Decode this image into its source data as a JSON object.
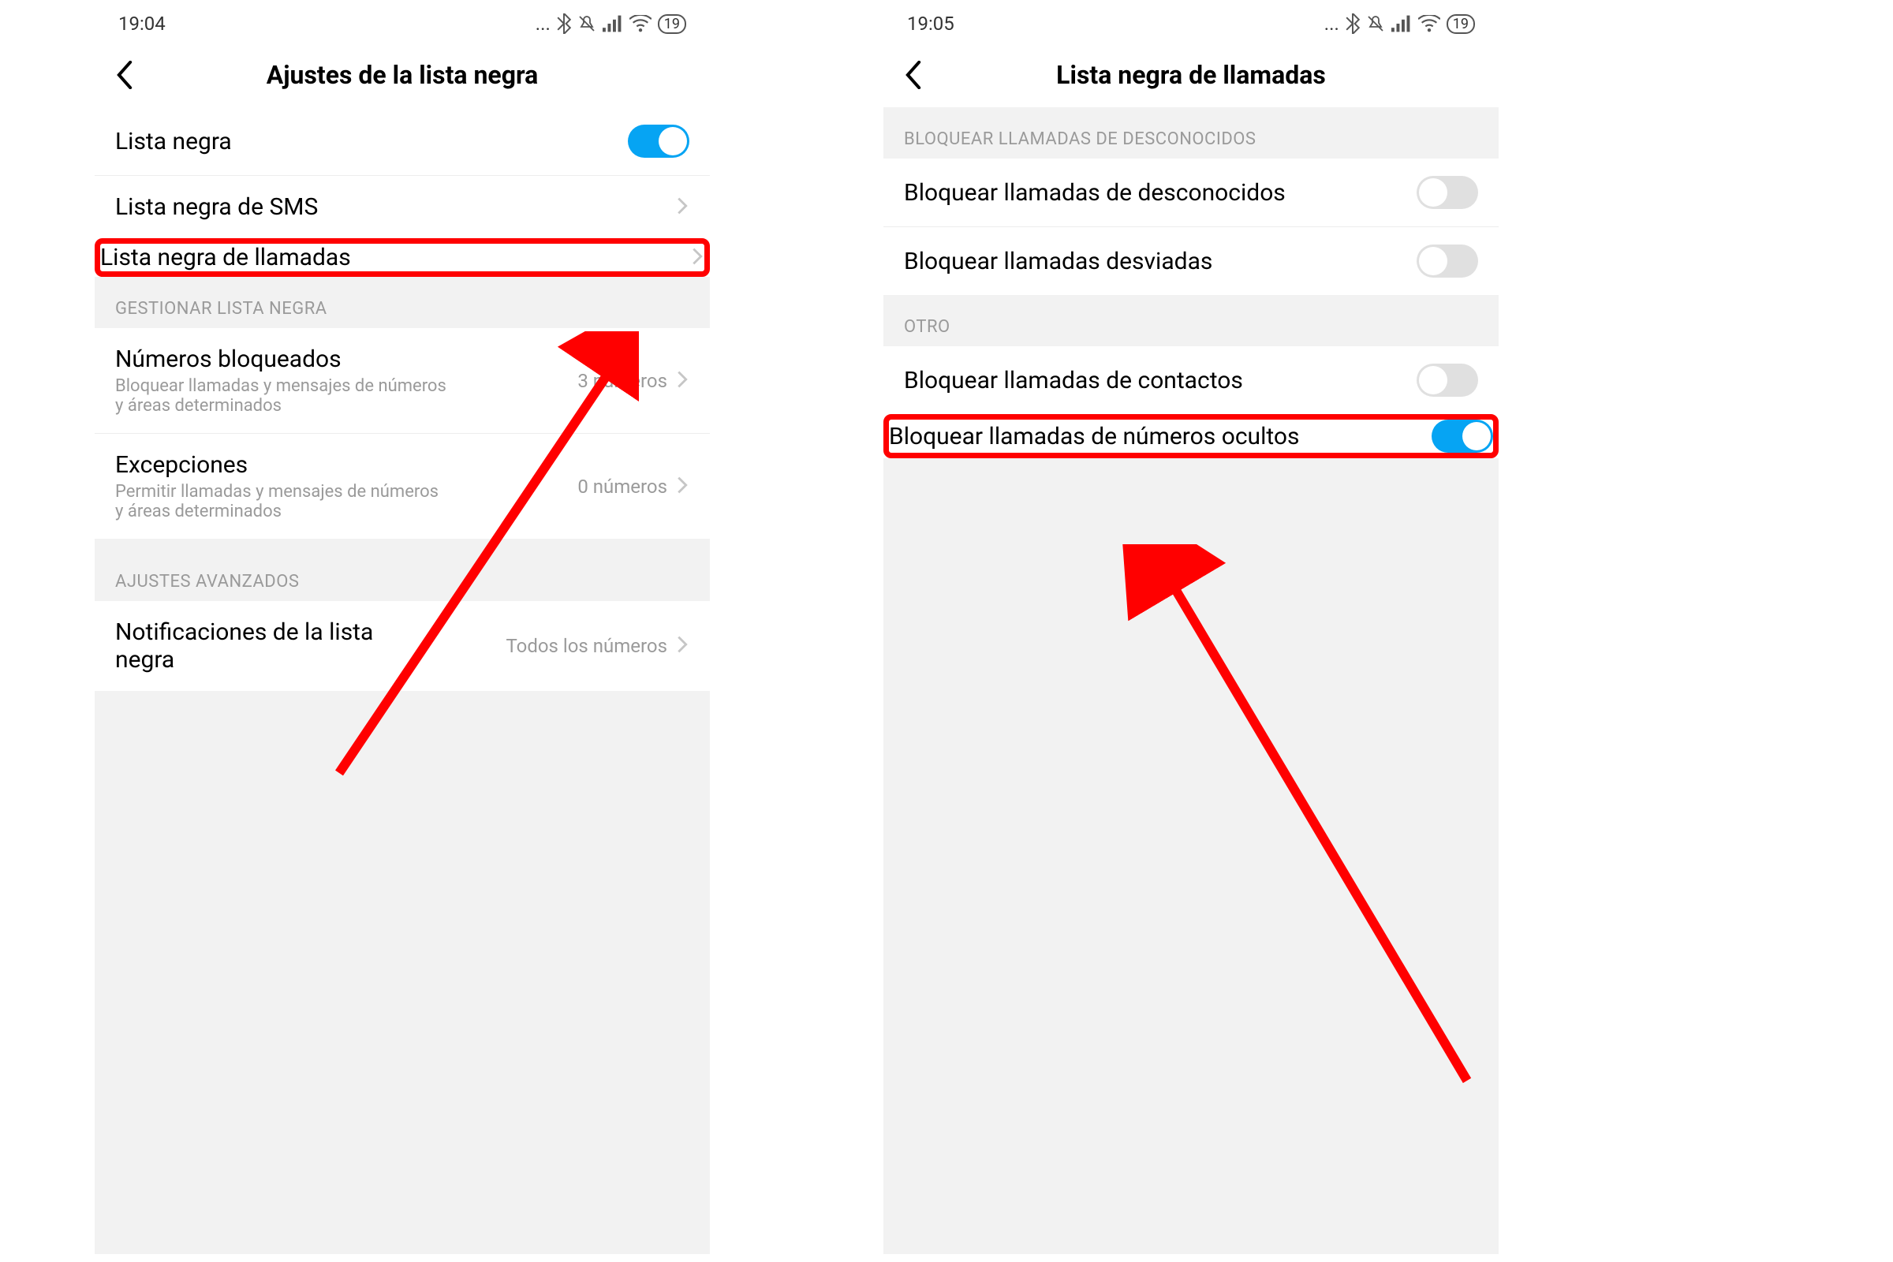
{
  "left": {
    "status": {
      "time": "19:04",
      "battery": "19"
    },
    "title": "Ajustes de la lista negra",
    "rows": {
      "lista_negra": "Lista negra",
      "lista_sms": "Lista negra de SMS",
      "lista_llamadas": "Lista negra de llamadas"
    },
    "sections": {
      "gestionar": "GESTIONAR LISTA NEGRA",
      "avanzados": "AJUSTES AVANZADOS"
    },
    "blocked": {
      "title": "Números bloqueados",
      "sub": "Bloquear llamadas y mensajes de números y áreas determinados",
      "val": "3 números"
    },
    "except": {
      "title": "Excepciones",
      "sub": "Permitir llamadas y mensajes de números y áreas determinados",
      "val": "0 números"
    },
    "notif": {
      "title": "Notificaciones de la lista negra",
      "val": "Todos los números"
    }
  },
  "right": {
    "status": {
      "time": "19:05",
      "battery": "19"
    },
    "title": "Lista negra de llamadas",
    "sections": {
      "desconocidos": "BLOQUEAR LLAMADAS DE DESCONOCIDOS",
      "otro": "OTRO"
    },
    "rows": {
      "desconocidos": "Bloquear llamadas de desconocidos",
      "desviadas": "Bloquear llamadas desviadas",
      "contactos": "Bloquear llamadas de contactos",
      "ocultos": "Bloquear llamadas de números ocultos"
    }
  }
}
